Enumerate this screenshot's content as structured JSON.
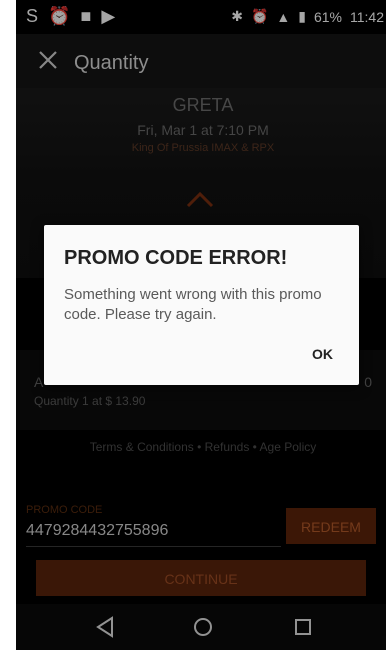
{
  "status_bar": {
    "battery": "61%",
    "time": "11:42"
  },
  "header": {
    "title": "Quantity"
  },
  "movie": {
    "name": "GRETA",
    "showtime": "Fri, Mar 1 at 7:10 PM",
    "location": "King Of Prussia IMAX & RPX"
  },
  "price": {
    "label_fragment": "A",
    "total_fragment": "0",
    "quantity": "Quantity 1 at $ 13.90"
  },
  "links": {
    "text": "Terms & Conditions • Refunds • Age Policy"
  },
  "promo": {
    "label": "PROMO CODE",
    "value": "4479284432755896",
    "redeem_label": "REDEEM"
  },
  "continue_label": "CONTINUE",
  "dialog": {
    "title": "PROMO CODE ERROR!",
    "message": "Something went wrong with this promo code. Please try again.",
    "ok_label": "OK"
  },
  "colors": {
    "accent": "#5c240a",
    "accent_text": "#b35a2a"
  }
}
